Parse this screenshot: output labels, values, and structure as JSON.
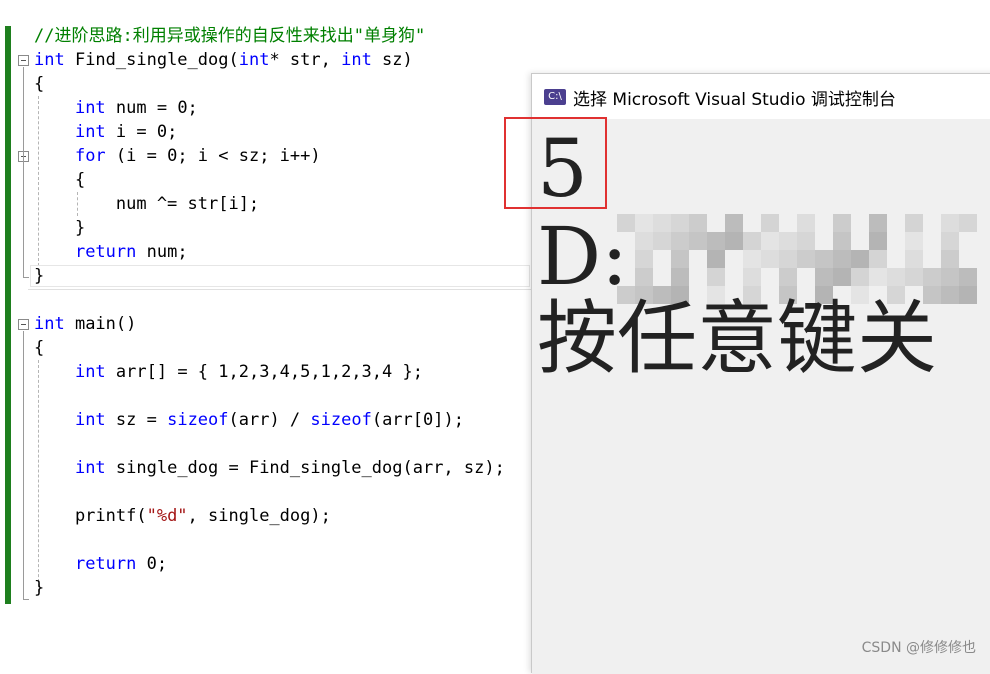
{
  "editor": {
    "lines": [
      {
        "segments": [
          {
            "t": "//进阶思路:利用异或操作的自反性来找出\"单身狗\"",
            "c": "cm"
          }
        ]
      },
      {
        "segments": [
          {
            "t": "int",
            "c": "kw"
          },
          {
            "t": " Find_single_dog(",
            "c": "fn"
          },
          {
            "t": "int",
            "c": "kw"
          },
          {
            "t": "* str, ",
            "c": "fn"
          },
          {
            "t": "int",
            "c": "kw"
          },
          {
            "t": " sz)",
            "c": "fn"
          }
        ]
      },
      {
        "segments": [
          {
            "t": "{",
            "c": "fn"
          }
        ]
      },
      {
        "segments": [
          {
            "t": "    ",
            "c": "fn"
          },
          {
            "t": "int",
            "c": "kw"
          },
          {
            "t": " num = 0;",
            "c": "fn"
          }
        ]
      },
      {
        "segments": [
          {
            "t": "    ",
            "c": "fn"
          },
          {
            "t": "int",
            "c": "kw"
          },
          {
            "t": " i = 0;",
            "c": "fn"
          }
        ]
      },
      {
        "segments": [
          {
            "t": "    ",
            "c": "fn"
          },
          {
            "t": "for",
            "c": "kw"
          },
          {
            "t": " (i = 0; i < sz; i++)",
            "c": "fn"
          }
        ]
      },
      {
        "segments": [
          {
            "t": "    {",
            "c": "fn"
          }
        ]
      },
      {
        "segments": [
          {
            "t": "        num ^= str[i];",
            "c": "fn"
          }
        ]
      },
      {
        "segments": [
          {
            "t": "    }",
            "c": "fn"
          }
        ]
      },
      {
        "segments": [
          {
            "t": "    ",
            "c": "fn"
          },
          {
            "t": "return",
            "c": "kw"
          },
          {
            "t": " num;",
            "c": "fn"
          }
        ]
      },
      {
        "segments": [
          {
            "t": "}",
            "c": "fn"
          }
        ]
      },
      {
        "segments": []
      },
      {
        "segments": [
          {
            "t": "int",
            "c": "kw"
          },
          {
            "t": " main()",
            "c": "fn"
          }
        ]
      },
      {
        "segments": [
          {
            "t": "{",
            "c": "fn"
          }
        ]
      },
      {
        "segments": [
          {
            "t": "    ",
            "c": "fn"
          },
          {
            "t": "int",
            "c": "kw"
          },
          {
            "t": " arr[] = { 1,2,3,4,5,1,2,3,4 };",
            "c": "fn"
          }
        ]
      },
      {
        "segments": []
      },
      {
        "segments": [
          {
            "t": "    ",
            "c": "fn"
          },
          {
            "t": "int",
            "c": "kw"
          },
          {
            "t": " sz = ",
            "c": "fn"
          },
          {
            "t": "sizeof",
            "c": "kw"
          },
          {
            "t": "(arr) / ",
            "c": "fn"
          },
          {
            "t": "sizeof",
            "c": "kw"
          },
          {
            "t": "(arr[0]);",
            "c": "fn"
          }
        ]
      },
      {
        "segments": []
      },
      {
        "segments": [
          {
            "t": "    ",
            "c": "fn"
          },
          {
            "t": "int",
            "c": "kw"
          },
          {
            "t": " single_dog = Find_single_dog(arr, sz);",
            "c": "fn"
          }
        ]
      },
      {
        "segments": []
      },
      {
        "segments": [
          {
            "t": "    printf(",
            "c": "fn"
          },
          {
            "t": "\"%d\"",
            "c": "str"
          },
          {
            "t": ", single_dog);",
            "c": "fn"
          }
        ]
      },
      {
        "segments": []
      },
      {
        "segments": [
          {
            "t": "    ",
            "c": "fn"
          },
          {
            "t": "return",
            "c": "kw"
          },
          {
            "t": " 0;",
            "c": "fn"
          }
        ]
      },
      {
        "segments": [
          {
            "t": "}",
            "c": "fn"
          }
        ]
      }
    ]
  },
  "console": {
    "icon_label": "C:\\",
    "title": "选择 Microsoft Visual Studio 调试控制台",
    "output": [
      "5",
      "D:",
      "按任意键关"
    ]
  },
  "watermark": "CSDN @修修修也",
  "colors": {
    "keyword": "#0000ff",
    "comment": "#008000",
    "string": "#a31515",
    "change_bar": "#1e7f1e",
    "highlight": "#e03131"
  }
}
